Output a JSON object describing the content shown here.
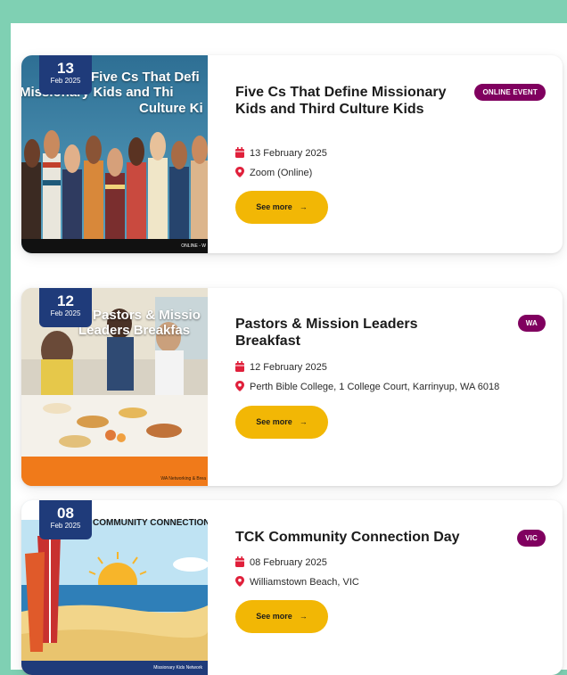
{
  "events": [
    {
      "day": "13",
      "month_year": "Feb 2025",
      "image_text_line1": "Five Cs That Defi",
      "image_text_line2": "Missionary Kids and Thi",
      "image_text_line3": "Culture Ki",
      "image_footer": "ONLINE - W",
      "title": "Five Cs That Define Missionary Kids and Third Culture Kids",
      "tag": "ONLINE EVENT",
      "date": "13 February 2025",
      "location": "Zoom (Online)",
      "button": "See more"
    },
    {
      "day": "12",
      "month_year": "Feb 2025",
      "image_text_line1": "Pastors & Missio",
      "image_text_line2": "Leaders Breakfas",
      "image_footer": "WA Networking & Brea",
      "title": "Pastors & Mission Leaders Breakfast",
      "tag": "WA",
      "date": "12 February 2025",
      "location": "Perth Bible College, 1 College Court, Karrinyup, WA 6018",
      "button": "See more"
    },
    {
      "day": "08",
      "month_year": "Feb 2025",
      "image_text_line1": "COMMUNITY CONNECTION I",
      "image_footer": "Missionary Kids Network",
      "title": "TCK Community Connection Day",
      "tag": "VIC",
      "date": "08 February 2025",
      "location": "Williamstown Beach, VIC",
      "button": "See more"
    }
  ],
  "icons": {
    "calendar": "calendar-icon",
    "pin": "location-pin-icon",
    "arrow": "arrow-right-icon"
  },
  "colors": {
    "accent": "#f2b705",
    "tag": "#80005f",
    "badge": "#1f3b7a",
    "icon_red": "#e0203b",
    "frame": "#7fd0b3"
  }
}
